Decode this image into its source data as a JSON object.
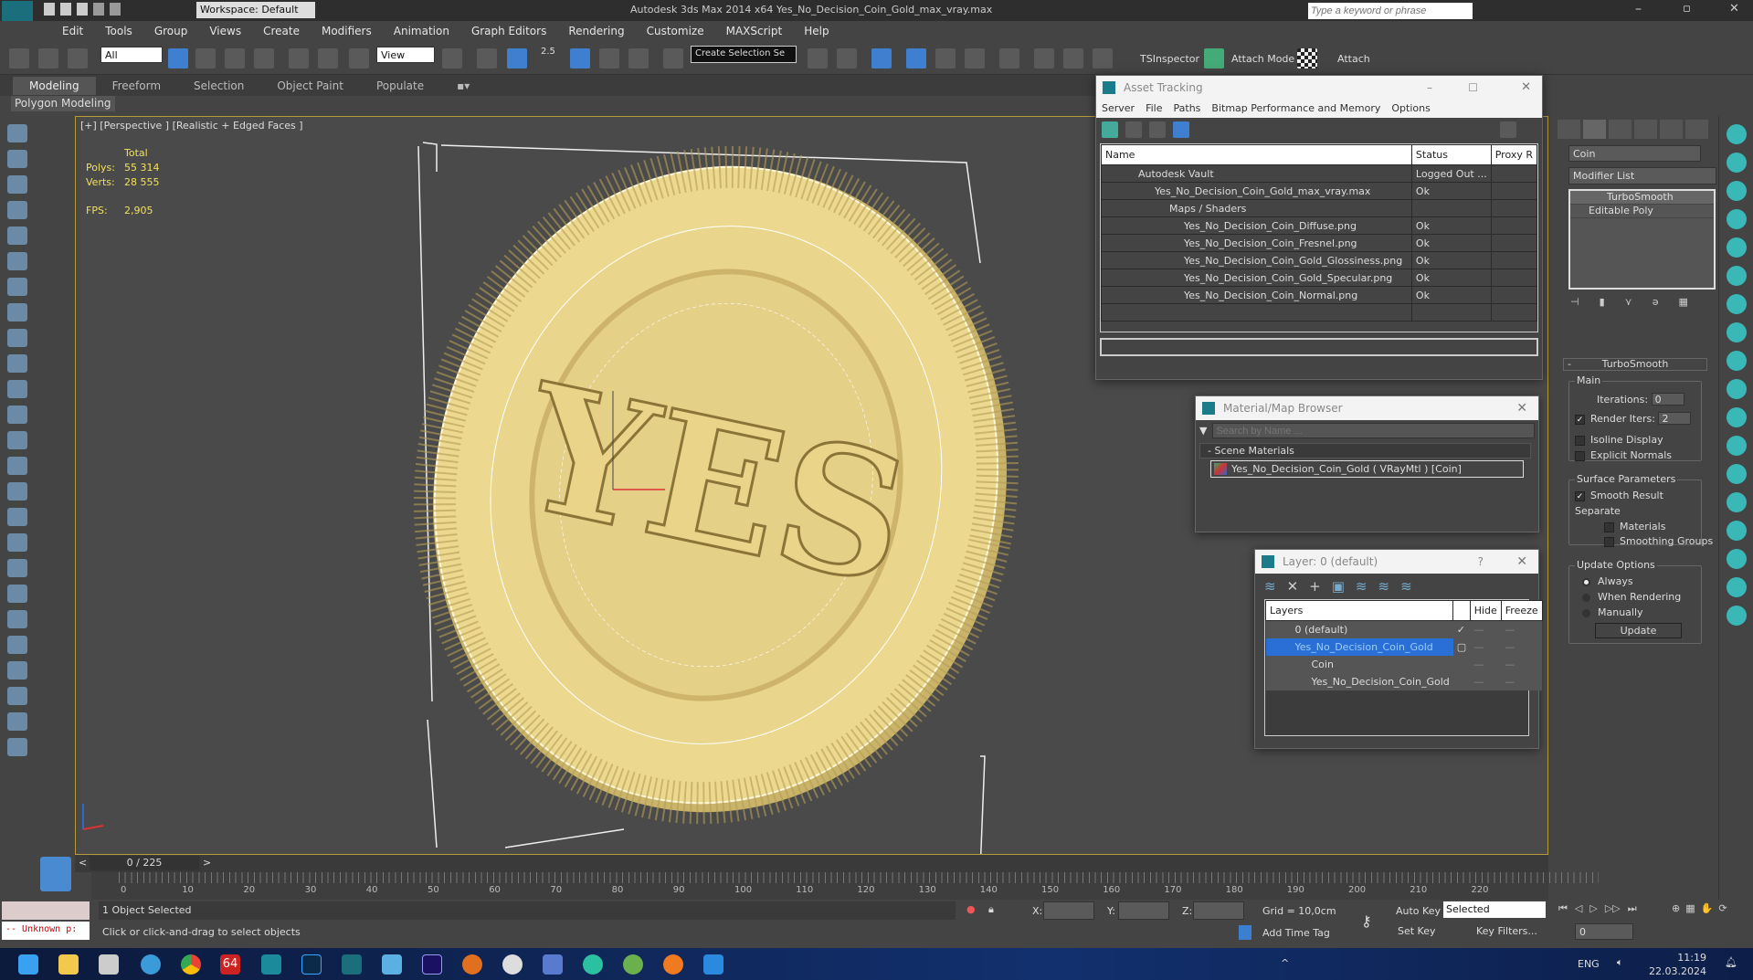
{
  "app": {
    "title": "Autodesk 3ds Max  2014 x64    Yes_No_Decision_Coin_Gold_max_vray.max",
    "workspace": "Workspace: Default",
    "search_placeholder": "Type a keyword or phrase"
  },
  "menu": [
    "Edit",
    "Tools",
    "Group",
    "Views",
    "Create",
    "Modifiers",
    "Animation",
    "Graph Editors",
    "Rendering",
    "Customize",
    "MAXScript",
    "Help"
  ],
  "toolbar": {
    "selection_filter": "All",
    "ref_coord": "View",
    "named_selection": "Create Selection Se",
    "snap_label": "2.5",
    "tsinspector": "TSInspector",
    "attach_mode": "Attach Mode",
    "attach": "Attach"
  },
  "ribbon": {
    "tabs": [
      "Modeling",
      "Freeform",
      "Selection",
      "Object Paint",
      "Populate"
    ],
    "active": "Modeling",
    "sub": "Polygon Modeling"
  },
  "viewport": {
    "label": "[+] [Perspective ] [Realistic + Edged Faces ]",
    "stats": {
      "total": "Total",
      "polys_label": "Polys:",
      "polys": "55 314",
      "verts_label": "Verts:",
      "verts": "28 555",
      "fps_label": "FPS:",
      "fps": "2,905"
    },
    "coin_text": "YES"
  },
  "asset_tracking": {
    "title": "Asset Tracking",
    "menu": [
      "Server",
      "File",
      "Paths",
      "Bitmap Performance and Memory",
      "Options"
    ],
    "columns": [
      "Name",
      "Status",
      "Proxy R"
    ],
    "rows": [
      {
        "name": "Autodesk Vault",
        "status": "Logged Out ..."
      },
      {
        "name": "Yes_No_Decision_Coin_Gold_max_vray.max",
        "status": "Ok"
      },
      {
        "name": "Maps / Shaders",
        "status": ""
      },
      {
        "name": "Yes_No_Decision_Coin_Diffuse.png",
        "status": "Ok"
      },
      {
        "name": "Yes_No_Decision_Coin_Fresnel.png",
        "status": "Ok"
      },
      {
        "name": "Yes_No_Decision_Coin_Gold_Glossiness.png",
        "status": "Ok"
      },
      {
        "name": "Yes_No_Decision_Coin_Gold_Specular.png",
        "status": "Ok"
      },
      {
        "name": "Yes_No_Decision_Coin_Normal.png",
        "status": "Ok"
      }
    ]
  },
  "material_browser": {
    "title": "Material/Map Browser",
    "search_placeholder": "Search by Name ...",
    "section": "- Scene Materials",
    "item": "Yes_No_Decision_Coin_Gold  ( VRayMtl ) [Coin]"
  },
  "layer_window": {
    "title": "Layer: 0 (default)",
    "help": "?",
    "columns": [
      "Layers",
      "Hide",
      "Freeze"
    ],
    "rows": [
      "0 (default)",
      "Yes_No_Decision_Coin_Gold",
      "Coin",
      "Yes_No_Decision_Coin_Gold"
    ]
  },
  "command_panel": {
    "object_name": "Coin",
    "modifier_list": "Modifier List",
    "stack": [
      "TurboSmooth",
      "Editable Poly"
    ],
    "rollout": "TurboSmooth",
    "main": "Main",
    "iterations_label": "Iterations:",
    "iterations": "0",
    "render_iters_label": "Render Iters:",
    "render_iters": "2",
    "render_iters_checked": true,
    "isoline": "Isoline Display",
    "explicit_normals": "Explicit Normals",
    "surface": "Surface Parameters",
    "smooth_result": "Smooth Result",
    "separate": "Separate",
    "materials": "Materials",
    "smoothing_groups": "Smoothing Groups",
    "update_options": "Update Options",
    "always": "Always",
    "when_rendering": "When Rendering",
    "manually": "Manually",
    "update": "Update"
  },
  "timeline": {
    "frame": "0 / 225",
    "ticks": [
      "0",
      "10",
      "20",
      "30",
      "40",
      "50",
      "60",
      "70",
      "80",
      "90",
      "100",
      "110",
      "120",
      "130",
      "140",
      "150",
      "160",
      "170",
      "180",
      "190",
      "200",
      "210",
      "220"
    ]
  },
  "status": {
    "selected": "1 Object Selected",
    "prompt": "Click or click-and-drag to select objects",
    "script": "-- Unknown p:",
    "x": "X:",
    "y": "Y:",
    "z": "Z:",
    "grid": "Grid = 10,0cm",
    "add_time_tag": "Add Time Tag",
    "auto_key": "Auto Key",
    "set_key": "Set Key",
    "key_mode": "Selected",
    "key_filters": "Key Filters...",
    "frame_field": "0"
  },
  "taskbar": {
    "lang": "ENG",
    "time": "11:19",
    "date": "22.03.2024",
    "badge": "64"
  },
  "colors": {
    "accent": "#3f7fd0",
    "coin": "#e8d58a",
    "viewport_border": "#b79a3a",
    "stats": "#f0e060"
  }
}
